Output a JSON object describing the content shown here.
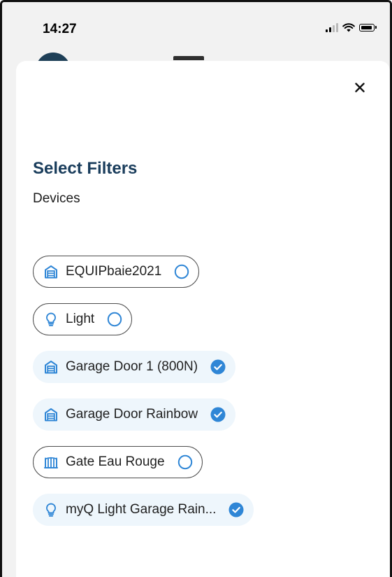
{
  "status_bar": {
    "time": "14:27"
  },
  "sheet": {
    "title": "Select Filters",
    "subtitle": "Devices",
    "close_icon": "close-icon"
  },
  "colors": {
    "title": "#1a3d5c",
    "accent": "#2f86d6",
    "selected_bg": "#eef6fc"
  },
  "filters": [
    {
      "label": "EQUIPbaie2021",
      "icon": "garage-door-icon",
      "selected": false
    },
    {
      "label": "Light",
      "icon": "lightbulb-icon",
      "selected": false
    },
    {
      "label": "Garage Door 1 (800N)",
      "icon": "garage-door-icon",
      "selected": true
    },
    {
      "label": "Garage Door Rainbow",
      "icon": "garage-door-icon",
      "selected": true
    },
    {
      "label": "Gate Eau Rouge",
      "icon": "gate-icon",
      "selected": false
    },
    {
      "label": "myQ Light Garage Rain...",
      "icon": "lightbulb-icon",
      "selected": true
    }
  ]
}
